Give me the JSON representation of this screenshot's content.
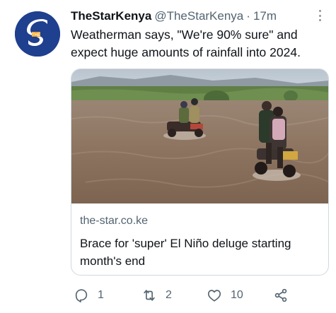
{
  "tweet": {
    "author_name": "TheStarKenya",
    "handle": "@TheStarKenya",
    "separator": "·",
    "time": "17m",
    "text": "Weatherman says, \"We're 90% sure\" and expect huge amounts of rainfall into 2024."
  },
  "card": {
    "domain": "the-star.co.ke",
    "title": "Brace for 'super' El Niño deluge starting month's end"
  },
  "actions": {
    "replies": "1",
    "retweets": "2",
    "likes": "10"
  },
  "icons": {
    "reply": "reply-icon",
    "retweet": "retweet-icon",
    "like": "heart-icon",
    "share": "share-icon",
    "more": "more-options-icon"
  },
  "colors": {
    "avatar": "#1f3f8f",
    "muted_text": "#536471",
    "card_border": "#cfd9de"
  }
}
